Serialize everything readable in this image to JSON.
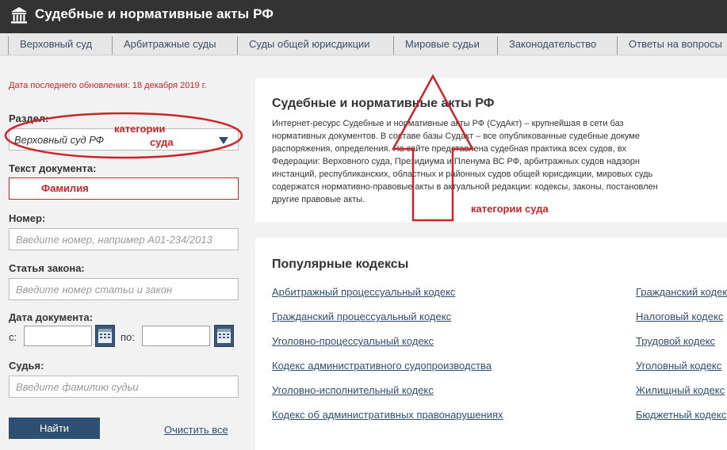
{
  "header": {
    "title": "Судебные и нормативные акты РФ",
    "logo_icon": "courthouse-icon"
  },
  "nav": {
    "items": [
      "Верховный суд",
      "Арбитражные суды",
      "Суды общей юрисдикции",
      "Мировые судьи",
      "Законодательство",
      "Ответы на вопросы"
    ]
  },
  "sidebar": {
    "update_note": "Дата последнего обновления: 18 декабря 2019 г.",
    "section_label": "Раздел:",
    "section_value": "Верховный суд РФ",
    "doc_text_label": "Текст документа:",
    "number_label": "Номер:",
    "number_placeholder": "Введите номер, например А01-234/2013",
    "law_label": "Статья закона:",
    "law_placeholder": "Введите номер статьи и закон",
    "date_label": "Дата документа:",
    "date_from": "с:",
    "date_to": "по:",
    "judge_label": "Судья:",
    "judge_placeholder": "Введите фамилию судьи",
    "find_button": "Найти",
    "clear_link": "Очистить все"
  },
  "annotations": {
    "category_line1": "категории",
    "category_line2": "суда",
    "surname": "Фамилия",
    "category_court": "категории суда",
    "color": "#c8262a"
  },
  "about": {
    "title": "Судебные и нормативные акты РФ",
    "lines": [
      "Интернет-ресурс Судебные и нормативные акты РФ (СудАкт) – крупнейшая в сети баз",
      "нормативных документов. В составе базы Судакт – все опубликованные судебные докуме",
      "распоряжения, определения. На сайте представлена судебная практика всех судов, вх",
      "Федерации: Верховного суда, Президиума и Пленума ВС РФ, арбитражных судов надзорн",
      "инстанций, республиканских, областных и районных судов общей юрисдикции, мировых судь",
      "содержатся нормативно-правовые акты в актуальной редакции: кодексы, законы, постановлен",
      "другие правовые акты."
    ]
  },
  "codes": {
    "title": "Популярные кодексы",
    "left": [
      "Арбитражный процессуальный кодекс",
      "Гражданский процессуальный кодекс",
      "Уголовно-процессуальный кодекс",
      "Кодекс административного судопроизводства",
      "Уголовно-исполнительный кодекс",
      "Кодекс об административных правонарушениях"
    ],
    "right": [
      "Гражданский кодекс",
      "Налоговый кодекс",
      "Трудовой кодекс",
      "Уголовный кодекс",
      "Жилищный кодекс",
      "Бюджетный кодекс"
    ]
  },
  "colors": {
    "header_bg": "#333333",
    "accent": "#2e4f72",
    "annotation": "#c8262a"
  }
}
